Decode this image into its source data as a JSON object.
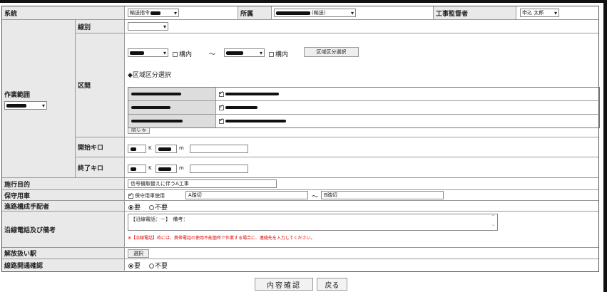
{
  "header": {
    "system_label": "系統",
    "system_value": "輸送指令",
    "affiliation_label": "所属",
    "affiliation_value": "(輸送)",
    "supervisor_label": "工事監督者",
    "supervisor_value": "申込 太郎"
  },
  "work_range": {
    "label": "作業範囲",
    "line_label": "線別",
    "line_value": "",
    "section_label": "区間",
    "within_station_1": "構内",
    "tilde": "～",
    "within_station_2": "構内",
    "section_select_button": "区域区分選択",
    "section_select_title": "◆区域区分選択",
    "subsections": [
      {
        "left": "",
        "right": ""
      },
      {
        "left": "",
        "right": ""
      },
      {
        "left": "",
        "right": ""
      }
    ],
    "close_button": "閉じる",
    "start_km_label": "開始キロ",
    "end_km_label": "終了キロ",
    "k_unit": "K",
    "m_unit": "m"
  },
  "purpose": {
    "label": "施行目的",
    "value": "信号機取替えに伴うA工事"
  },
  "vehicle": {
    "label": "保守用車",
    "checkbox_label": "保守用車使用",
    "from_value": "A踏切",
    "tilde": "～",
    "to_value": "B踏切"
  },
  "track_guard": {
    "label": "進路構成手配者",
    "yes": "要",
    "no": "不要"
  },
  "phone": {
    "label": "沿線電話及び備考",
    "value": "【沿線電話：－】　備考：",
    "note": "※【沿線電話】枠には、携帯電話の使用不能箇所で作業する場合に、連絡先を入力してください。"
  },
  "release_station": {
    "label": "解放扱い駅",
    "button": "選択"
  },
  "line_open": {
    "label": "線路開通確認",
    "yes": "要",
    "no": "不要"
  },
  "footer": {
    "confirm_button": "内容確認",
    "back_button": "戻る"
  }
}
